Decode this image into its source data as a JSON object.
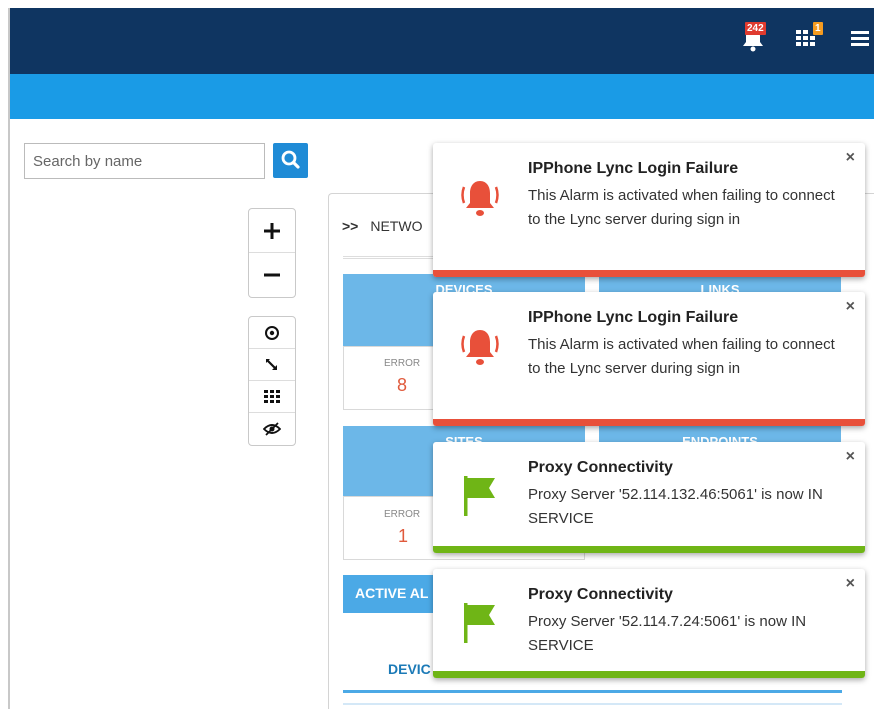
{
  "header": {
    "alarm_badge": "242",
    "tasks_badge": "1"
  },
  "search": {
    "placeholder": "Search by name"
  },
  "panel": {
    "title": "NETWO"
  },
  "tiles": [
    {
      "label": "DEVICES",
      "error_label": "ERROR",
      "error_value": "8"
    },
    {
      "label": "LINKS"
    },
    {
      "label": "SITES",
      "error_label": "ERROR",
      "error_value": "1"
    },
    {
      "label": "ENDPOINTS"
    }
  ],
  "active_alarms": {
    "label": "ACTIVE AL",
    "tab": "DEVIC"
  },
  "notifications": [
    {
      "title": "IPPhone Lync Login Failure",
      "message": "This Alarm is activated when failing to connect to the Lync server during sign in",
      "type": "alarm",
      "color": "#e8503a"
    },
    {
      "title": "IPPhone Lync Login Failure",
      "message": "This Alarm is activated when failing to connect to the Lync server during sign in",
      "type": "alarm",
      "color": "#e8503a"
    },
    {
      "title": "Proxy Connectivity",
      "message": "Proxy Server '52.114.132.46:5061' is now IN SERVICE",
      "type": "flag",
      "color": "#6fb516"
    },
    {
      "title": "Proxy Connectivity",
      "message": "Proxy Server '52.114.7.24:5061' is now IN SERVICE",
      "type": "flag",
      "color": "#6fb516"
    }
  ],
  "close_symbol": "×"
}
